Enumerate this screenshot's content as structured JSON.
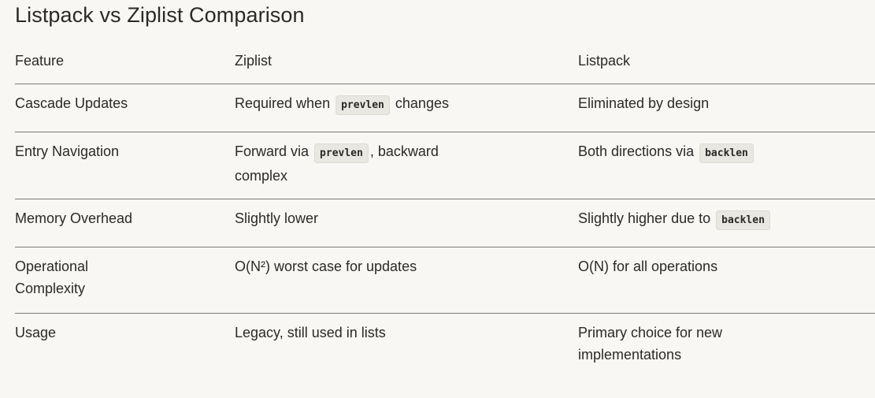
{
  "title": "Listpack vs Ziplist Comparison",
  "table": {
    "headers": [
      "Feature",
      "Ziplist",
      "Listpack"
    ],
    "rows": [
      {
        "feature": "Cascade Updates",
        "ziplist": {
          "before": "Required when",
          "code": "prevlen",
          "after": "changes"
        },
        "listpack": {
          "text": "Eliminated by design"
        }
      },
      {
        "feature": "Entry Navigation",
        "ziplist": {
          "before": "Forward via",
          "code": "prevlen",
          "after": ", backward complex"
        },
        "listpack": {
          "before": "Both directions via",
          "code": "backlen"
        }
      },
      {
        "feature": "Memory Overhead",
        "ziplist": {
          "text": "Slightly lower"
        },
        "listpack": {
          "before": "Slightly higher due to",
          "code": "backlen"
        }
      },
      {
        "feature": "Operational Complexity",
        "ziplist": {
          "text": "O(N²) worst case for updates"
        },
        "listpack": {
          "text": "O(N) for all operations"
        }
      },
      {
        "feature": "Usage",
        "ziplist": {
          "text": "Legacy, still used in lists"
        },
        "listpack": {
          "text": "Primary choice for new implementations"
        }
      }
    ]
  }
}
